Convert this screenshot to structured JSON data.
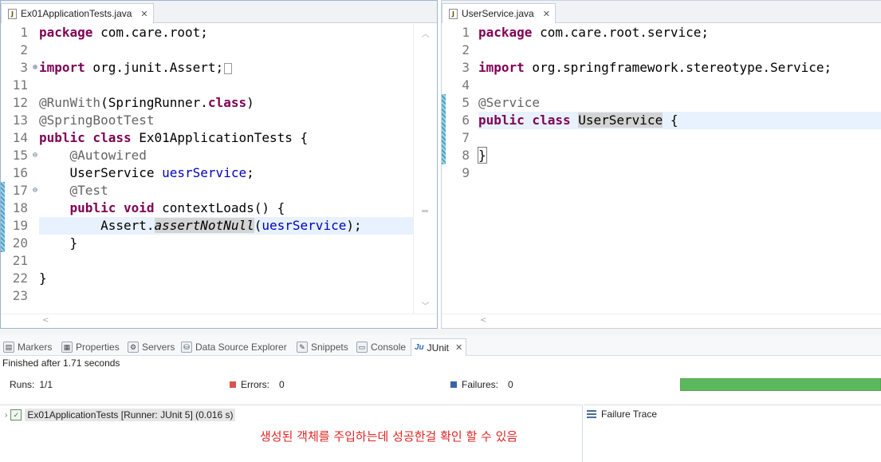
{
  "editors": {
    "left": {
      "tab_label": "Ex01ApplicationTests.java",
      "lines": [
        {
          "num": "1",
          "fold": ""
        },
        {
          "num": "2",
          "fold": ""
        },
        {
          "num": "3",
          "fold": "⊕"
        },
        {
          "num": "11",
          "fold": ""
        },
        {
          "num": "12",
          "fold": ""
        },
        {
          "num": "13",
          "fold": ""
        },
        {
          "num": "14",
          "fold": ""
        },
        {
          "num": "15",
          "fold": "⊖"
        },
        {
          "num": "16",
          "fold": ""
        },
        {
          "num": "17",
          "fold": "⊖"
        },
        {
          "num": "18",
          "fold": ""
        },
        {
          "num": "19",
          "fold": ""
        },
        {
          "num": "20",
          "fold": ""
        },
        {
          "num": "21",
          "fold": ""
        },
        {
          "num": "22",
          "fold": ""
        },
        {
          "num": "23",
          "fold": ""
        }
      ],
      "code": {
        "l1_kw": "package",
        "l1_rest": " com.care.root;",
        "l3_kw": "import",
        "l3_rest": " org.junit.Assert;",
        "l12_ann": "@RunWith",
        "l12_mid": "(SpringRunner.",
        "l12_kw": "class",
        "l12_end": ")",
        "l13_ann": "@SpringBootTest",
        "l14_kw": "public class",
        "l14_rest": " Ex01ApplicationTests {",
        "l15_ann": "    @Autowired",
        "l16_type": "    UserService ",
        "l16_field": "uesrService",
        "l16_end": ";",
        "l17_ann": "    @Test",
        "l18_kw": "    public void",
        "l18_rest": " contextLoads() {",
        "l19_pre": "        Assert.",
        "l19_method": "assertNotNull",
        "l19_open": "(",
        "l19_field": "uesrService",
        "l19_end": ");",
        "l20": "    }",
        "l22": "}"
      }
    },
    "right": {
      "tab_label": "UserService.java",
      "lines": [
        {
          "num": "1"
        },
        {
          "num": "2"
        },
        {
          "num": "3"
        },
        {
          "num": "4"
        },
        {
          "num": "5"
        },
        {
          "num": "6"
        },
        {
          "num": "7"
        },
        {
          "num": "8"
        },
        {
          "num": "9"
        }
      ],
      "code": {
        "l1_kw": "package",
        "l1_rest": " com.care.root.service;",
        "l3_kw": "import",
        "l3_rest": " org.springframework.stereotype.Service;",
        "l5_ann": "@Service",
        "l6_kw": "public class",
        "l6_sp": " ",
        "l6_name": "UserService",
        "l6_end": " {",
        "l8": "}"
      }
    }
  },
  "views": {
    "tabs": [
      {
        "label": "Markers",
        "icon": "markers-icon"
      },
      {
        "label": "Properties",
        "icon": "properties-icon"
      },
      {
        "label": "Servers",
        "icon": "servers-icon"
      },
      {
        "label": "Data Source Explorer",
        "icon": "data-source-icon"
      },
      {
        "label": "Snippets",
        "icon": "snippets-icon"
      },
      {
        "label": "Console",
        "icon": "console-icon"
      },
      {
        "label": "JUnit",
        "icon": "junit-icon"
      }
    ]
  },
  "junit": {
    "finished": "Finished after 1.71 seconds",
    "runs_label": "Runs:",
    "runs_value": "1/1",
    "errors_label": "Errors:",
    "errors_value": "0",
    "failures_label": "Failures:",
    "failures_value": "0",
    "progress": 1.0,
    "progress_color": "#5cb85c",
    "test_item": "Ex01ApplicationTests [Runner: JUnit 5] (0.016 s)",
    "annotation": "생성된 객체를 주입하는데 성공한걸 확인 할 수 있음",
    "failure_trace": "Failure Trace"
  }
}
